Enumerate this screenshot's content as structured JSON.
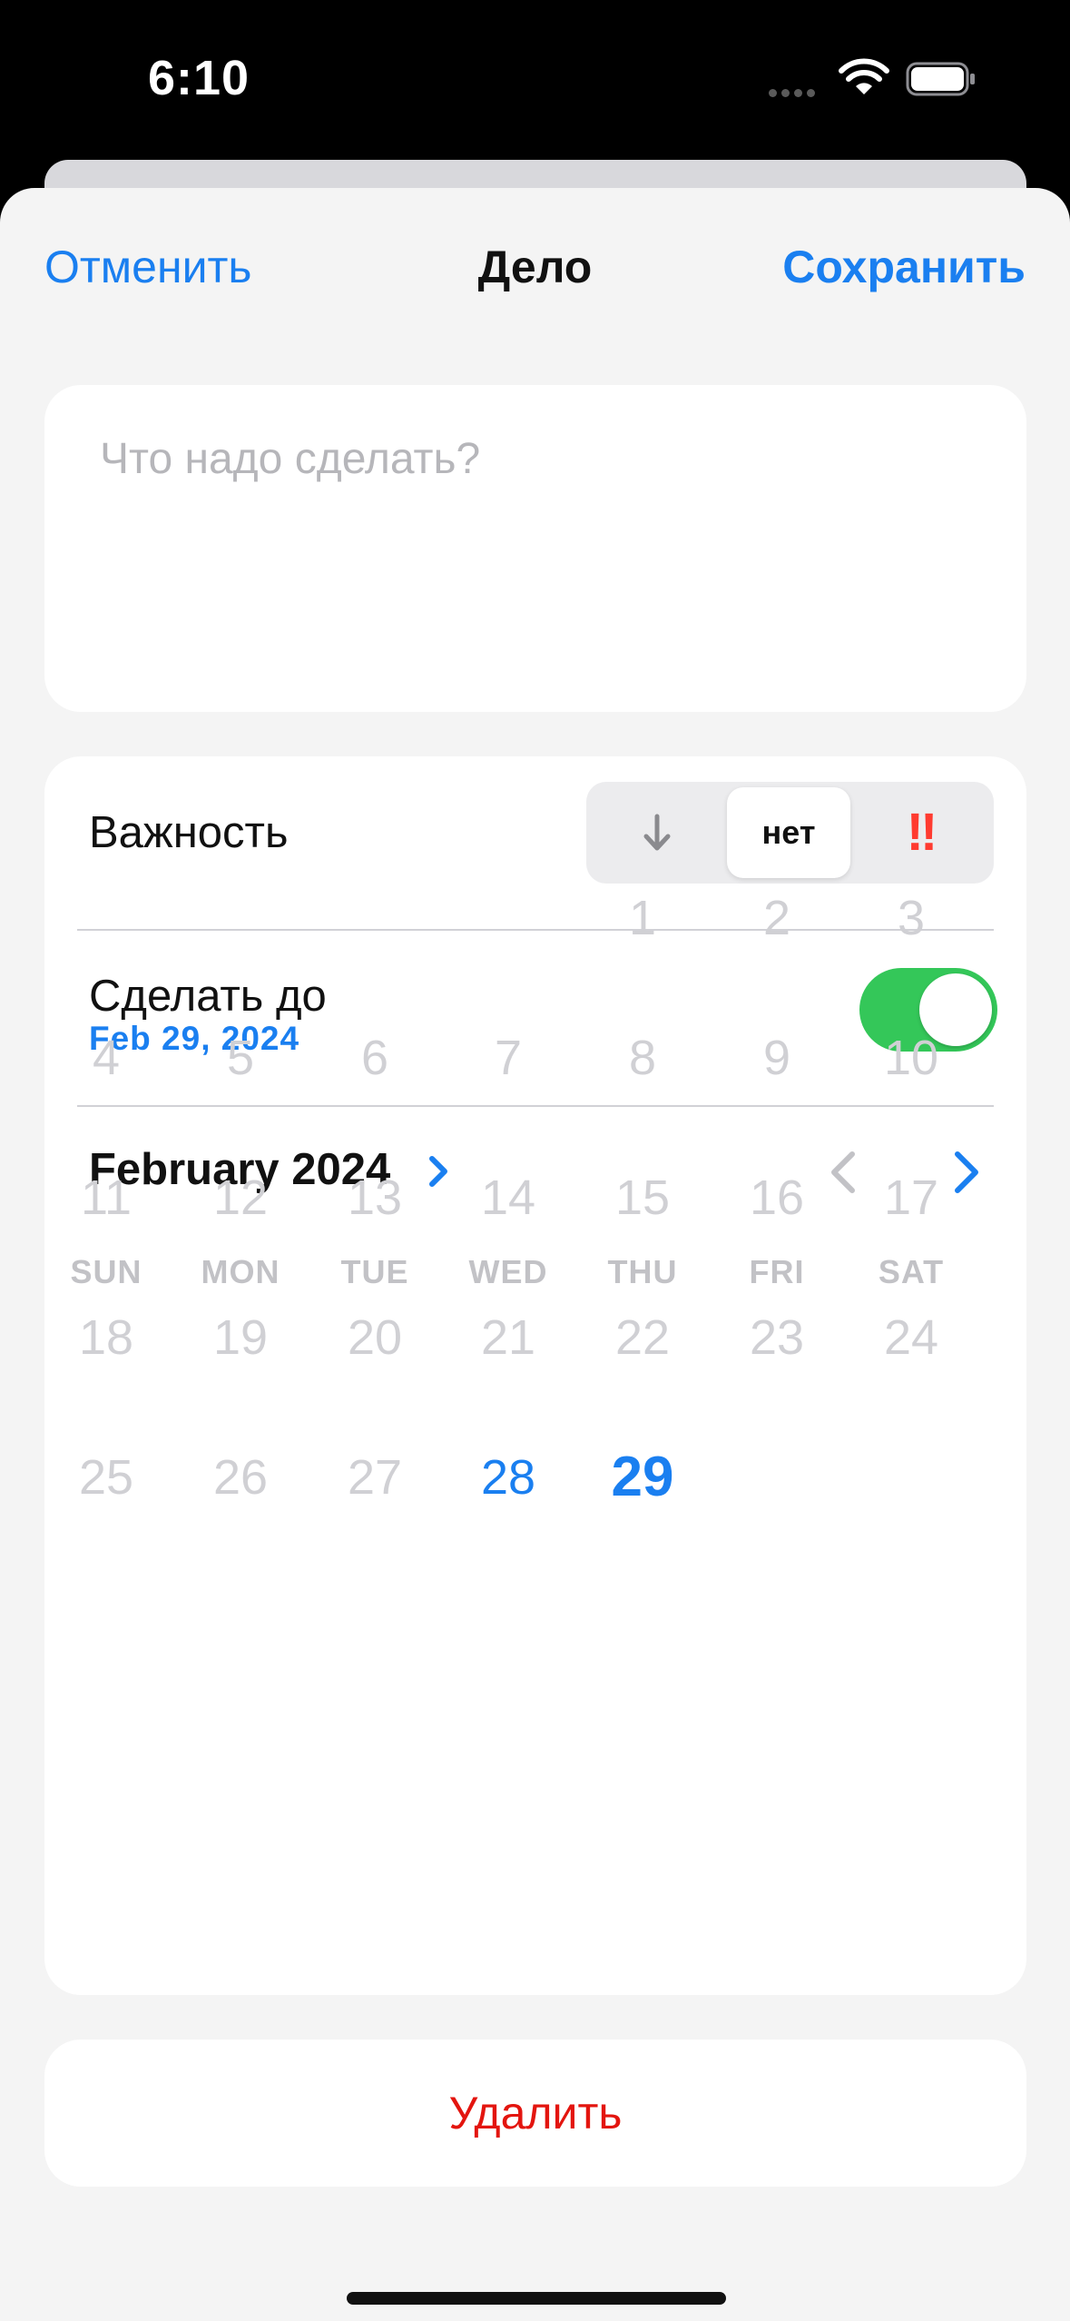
{
  "status": {
    "time": "6:10"
  },
  "nav": {
    "cancel": "Отменить",
    "title": "Дело",
    "save": "Сохранить"
  },
  "task": {
    "placeholder": "Что надо сделать?"
  },
  "importance": {
    "label": "Важность",
    "options": [
      {
        "type": "low",
        "icon": "arrow-down-icon"
      },
      {
        "type": "none",
        "label": "нет"
      },
      {
        "type": "high",
        "label": "!!"
      }
    ],
    "selected": "нет"
  },
  "deadline": {
    "label": "Сделать до",
    "date": "Feb 29, 2024",
    "enabled": true
  },
  "calendar": {
    "month_title": "February 2024",
    "weekdays": [
      "SUN",
      "MON",
      "TUE",
      "WED",
      "THU",
      "FRI",
      "SAT"
    ],
    "days": [
      "1",
      "2",
      "3",
      "4",
      "5",
      "6",
      "7",
      "8",
      "9",
      "10",
      "11",
      "12",
      "13",
      "14",
      "15",
      "16",
      "17",
      "18",
      "19",
      "20",
      "21",
      "22",
      "23",
      "24",
      "25",
      "26",
      "27",
      "28",
      "29"
    ],
    "first_weekday_index": 4,
    "available_days": [
      "28",
      "29"
    ],
    "selected_day": "29"
  },
  "actions": {
    "delete": "Удалить"
  },
  "colors": {
    "accent": "#1a7ff0",
    "toggle_on": "#34c759",
    "danger": "#e3150f",
    "high_priority": "#ff3b30"
  }
}
